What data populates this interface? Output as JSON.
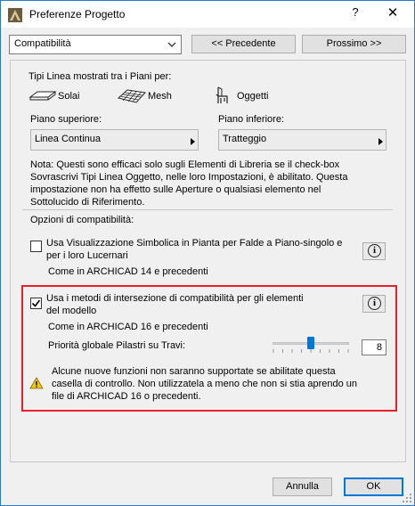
{
  "window": {
    "title": "Preferenze Progetto",
    "help_glyph": "?",
    "close_glyph": "✕"
  },
  "top": {
    "dropdown_value": "Compatibilità",
    "prev_label": "<< Precedente",
    "next_label": "Prossimo >>"
  },
  "linetypes": {
    "heading": "Tipi Linea mostrati tra i Piani per:",
    "solai": "Solai",
    "mesh": "Mesh",
    "oggetti": "Oggetti",
    "upper_label": "Piano superiore:",
    "lower_label": "Piano inferiore:",
    "upper_value": "Linea Continua",
    "lower_value": "Tratteggio",
    "note_lines": [
      "Nota: Questi sono efficaci solo sugli Elementi di Libreria se il check-box",
      "Sovrascrivi Tipi Linea Oggetto, nelle loro Impostazioni, è abilitato. Questa",
      "impostazione non ha effetto sulle Aperture o qualsiasi elemento nel",
      "Sottolucido di Riferimento."
    ]
  },
  "compat": {
    "heading": "Opzioni di compatibilità:",
    "opt1_lines": [
      "Usa Visualizzazione Simbolica in Pianta per Falde a Piano-singolo e",
      "per i loro Lucernari"
    ],
    "opt1_checked": false,
    "opt1_note": "Come in ARCHICAD 14 e precedenti",
    "opt2_lines": [
      "Usa i metodi di intersezione di compatibilità per gli elementi",
      "del modello"
    ],
    "opt2_checked": true,
    "opt2_note": "Come in ARCHICAD 16 e precedenti",
    "priority_label": "Priorità globale Pilastri su Travi:",
    "priority_value": "8",
    "warning_lines": [
      "Alcune nuove funzioni non saranno supportate se abilitate questa",
      "casella di controllo. Non utilizzatela a meno che non si stia aprendo un",
      "file di ARCHICAD 16 o precedenti."
    ]
  },
  "footer": {
    "cancel_label": "Annulla",
    "ok_label": "OK"
  },
  "colors": {
    "highlight": "#e8202a",
    "accent": "#0078d7",
    "warning": "#f2c811"
  }
}
